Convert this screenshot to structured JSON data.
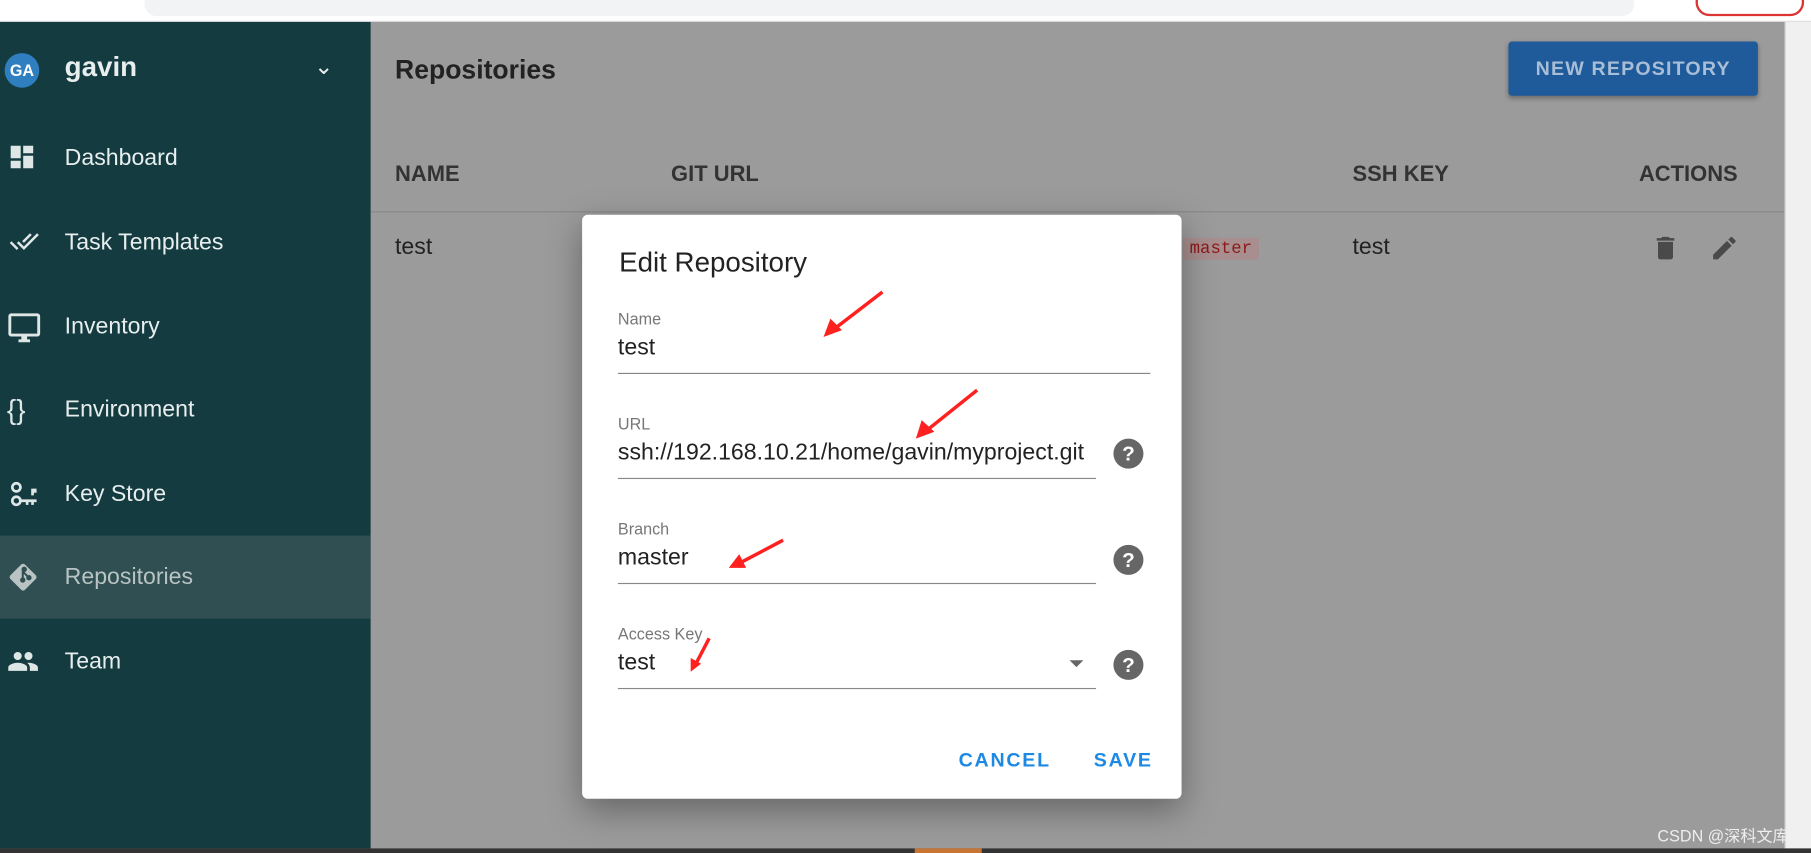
{
  "sidebar": {
    "user": {
      "initials": "GA",
      "name": "gavin"
    },
    "items": [
      {
        "label": "Dashboard",
        "icon": "dashboard-icon"
      },
      {
        "label": "Task Templates",
        "icon": "double-check-icon"
      },
      {
        "label": "Inventory",
        "icon": "monitor-icon"
      },
      {
        "label": "Environment",
        "icon": "braces-icon"
      },
      {
        "label": "Key Store",
        "icon": "key-icon"
      },
      {
        "label": "Repositories",
        "icon": "git-icon",
        "active": true
      },
      {
        "label": "Team",
        "icon": "people-icon"
      }
    ]
  },
  "main": {
    "title": "Repositories",
    "new_button": "NEW REPOSITORY",
    "columns": [
      "NAME",
      "GIT URL",
      "SSH KEY",
      "ACTIONS"
    ],
    "rows": [
      {
        "name": "test",
        "branch": "master",
        "ssh_key": "test"
      }
    ]
  },
  "dialog": {
    "title": "Edit Repository",
    "fields": [
      {
        "label": "Name",
        "value": "test"
      },
      {
        "label": "URL",
        "value": "ssh://192.168.10.21/home/gavin/myproject.git"
      },
      {
        "label": "Branch",
        "value": "master"
      },
      {
        "label": "Access Key",
        "value": "test"
      }
    ],
    "cancel": "CANCEL",
    "save": "SAVE"
  },
  "colors": {
    "sidebar": "#133b40",
    "accent": "#1e88e5",
    "primary_button": "#1f5a9a",
    "annotation_arrow": "#ff2020"
  },
  "watermark": "CSDN @深科文库"
}
